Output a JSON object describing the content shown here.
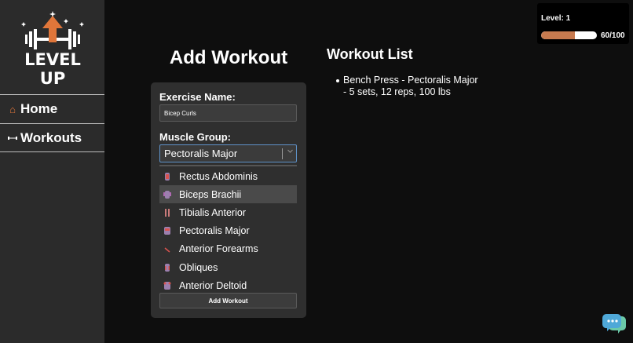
{
  "brand": {
    "logo_text": "LEVEL UP"
  },
  "nav": {
    "items": [
      {
        "label": "Home",
        "icon": "home-icon"
      },
      {
        "label": "Workouts",
        "icon": "dumbbell-icon"
      }
    ]
  },
  "level": {
    "label": "Level: 1",
    "progress_text": "60/100",
    "progress_fraction": 0.6,
    "fill_color": "#c77a4f"
  },
  "form": {
    "title": "Add Workout",
    "exercise_label": "Exercise Name:",
    "exercise_value": "Bicep Curls",
    "muscle_label": "Muscle Group:",
    "muscle_selected": "Pectoralis Major",
    "muscle_options": [
      {
        "label": "Rectus Abdominis",
        "icon": "abdomen-icon"
      },
      {
        "label": "Biceps Brachii",
        "icon": "arms-icon",
        "highlighted": true
      },
      {
        "label": "Tibialis Anterior",
        "icon": "legs-icon"
      },
      {
        "label": "Pectoralis Major",
        "icon": "chest-icon"
      },
      {
        "label": "Anterior Forearms",
        "icon": "forearm-icon"
      },
      {
        "label": "Obliques",
        "icon": "torso-icon"
      },
      {
        "label": "Anterior Deltoid",
        "icon": "shoulder-icon"
      }
    ],
    "submit_label": "Add Workout"
  },
  "workouts": {
    "title": "Workout List",
    "items": [
      {
        "line1": "Bench Press - Pectoralis Major",
        "line2": "- 5 sets, 12 reps, 100 lbs"
      }
    ]
  },
  "colors": {
    "accent": "#e0763a",
    "background": "#0e0e0e",
    "sidebar": "#2b2b2b",
    "card": "#2f2f2f"
  }
}
